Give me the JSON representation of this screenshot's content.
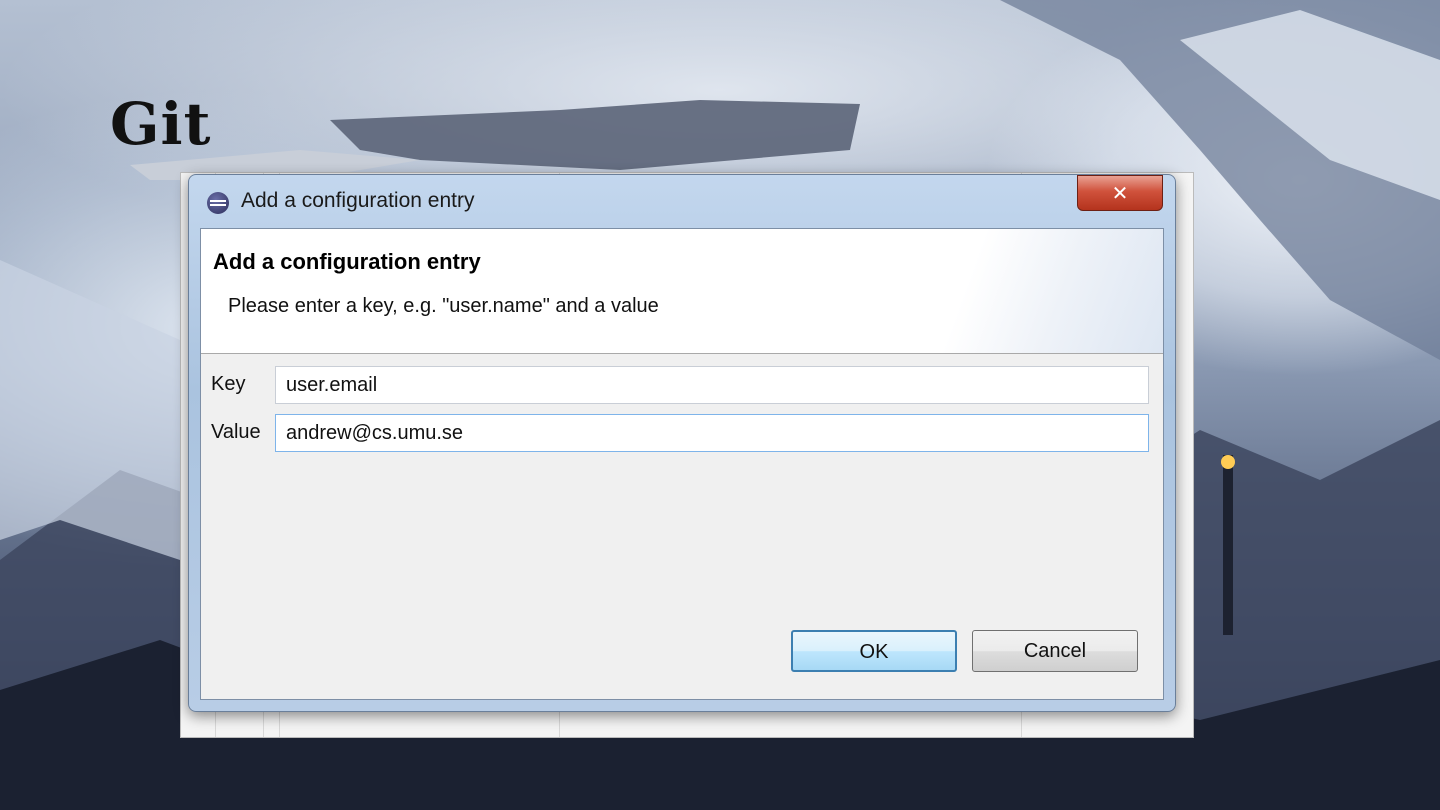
{
  "slide": {
    "title": "Git"
  },
  "dialog": {
    "window_title": "Add a configuration entry",
    "close_glyph": "✕",
    "header_title": "Add a configuration entry",
    "header_message": "Please enter a key, e.g. \"user.name\" and a value",
    "fields": {
      "key": {
        "label": "Key",
        "value": "user.email"
      },
      "value": {
        "label": "Value",
        "value": "andrew@cs.umu.se"
      }
    },
    "buttons": {
      "ok": "OK",
      "cancel": "Cancel"
    }
  },
  "icons": {
    "app": "eclipse-icon",
    "close": "close-icon"
  }
}
